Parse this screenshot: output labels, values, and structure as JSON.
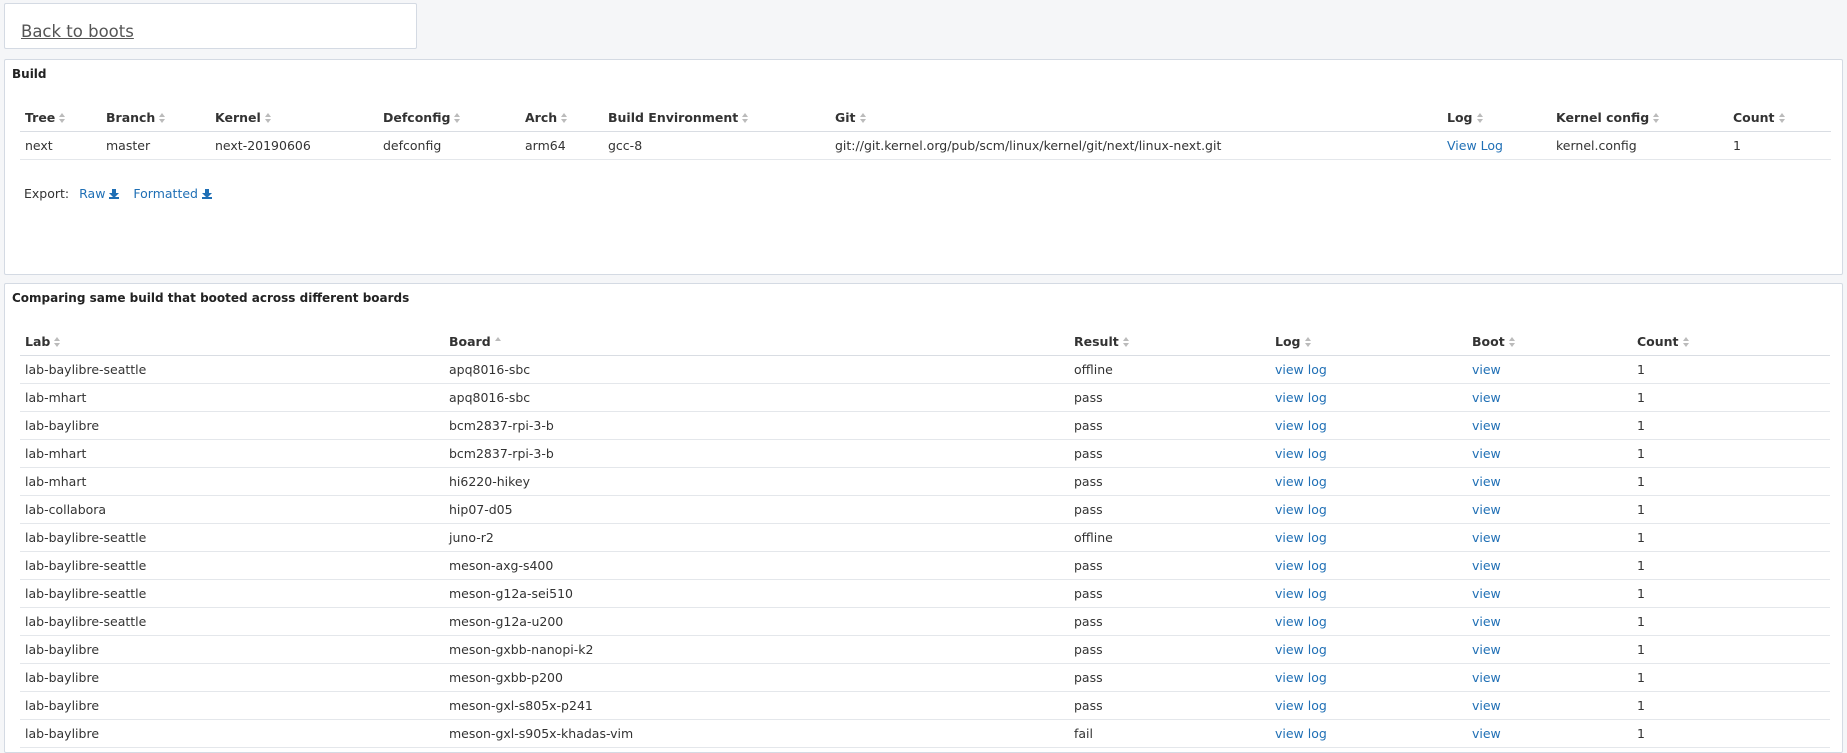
{
  "back_link": "Back to boots",
  "build_panel": {
    "title": "Build",
    "columns": [
      "Tree",
      "Branch",
      "Kernel",
      "Defconfig",
      "Arch",
      "Build Environment",
      "Git",
      "Log",
      "Kernel config",
      "Count"
    ],
    "row": {
      "tree": "next",
      "branch": "master",
      "kernel": "next-20190606",
      "defconfig": "defconfig",
      "arch": "arm64",
      "build_env": "gcc-8",
      "git": "git://git.kernel.org/pub/scm/linux/kernel/git/next/linux-next.git",
      "log": "View Log",
      "kernel_config": "kernel.config",
      "count": "1"
    },
    "export": {
      "label": "Export:",
      "raw": "Raw",
      "formatted": "Formatted",
      "icon": "download-icon"
    }
  },
  "compare_panel": {
    "title": "Comparing same build that booted across different boards",
    "columns": [
      "Lab",
      "Board",
      "Result",
      "Log",
      "Boot",
      "Count"
    ],
    "rows": [
      {
        "lab": "lab-baylibre-seattle",
        "board": "apq8016-sbc",
        "result": "offline",
        "log": "view log",
        "boot": "view",
        "count": "1"
      },
      {
        "lab": "lab-mhart",
        "board": "apq8016-sbc",
        "result": "pass",
        "log": "view log",
        "boot": "view",
        "count": "1"
      },
      {
        "lab": "lab-baylibre",
        "board": "bcm2837-rpi-3-b",
        "result": "pass",
        "log": "view log",
        "boot": "view",
        "count": "1"
      },
      {
        "lab": "lab-mhart",
        "board": "bcm2837-rpi-3-b",
        "result": "pass",
        "log": "view log",
        "boot": "view",
        "count": "1"
      },
      {
        "lab": "lab-mhart",
        "board": "hi6220-hikey",
        "result": "pass",
        "log": "view log",
        "boot": "view",
        "count": "1"
      },
      {
        "lab": "lab-collabora",
        "board": "hip07-d05",
        "result": "pass",
        "log": "view log",
        "boot": "view",
        "count": "1"
      },
      {
        "lab": "lab-baylibre-seattle",
        "board": "juno-r2",
        "result": "offline",
        "log": "view log",
        "boot": "view",
        "count": "1"
      },
      {
        "lab": "lab-baylibre-seattle",
        "board": "meson-axg-s400",
        "result": "pass",
        "log": "view log",
        "boot": "view",
        "count": "1"
      },
      {
        "lab": "lab-baylibre-seattle",
        "board": "meson-g12a-sei510",
        "result": "pass",
        "log": "view log",
        "boot": "view",
        "count": "1"
      },
      {
        "lab": "lab-baylibre-seattle",
        "board": "meson-g12a-u200",
        "result": "pass",
        "log": "view log",
        "boot": "view",
        "count": "1"
      },
      {
        "lab": "lab-baylibre",
        "board": "meson-gxbb-nanopi-k2",
        "result": "pass",
        "log": "view log",
        "boot": "view",
        "count": "1"
      },
      {
        "lab": "lab-baylibre",
        "board": "meson-gxbb-p200",
        "result": "pass",
        "log": "view log",
        "boot": "view",
        "count": "1"
      },
      {
        "lab": "lab-baylibre",
        "board": "meson-gxl-s805x-p241",
        "result": "pass",
        "log": "view log",
        "boot": "view",
        "count": "1"
      },
      {
        "lab": "lab-baylibre",
        "board": "meson-gxl-s905x-khadas-vim",
        "result": "fail",
        "log": "view log",
        "boot": "view",
        "count": "1"
      }
    ]
  },
  "colors": {
    "link": "#1f6fb5",
    "background": "#f5f6f8",
    "border": "#d4dae3"
  }
}
